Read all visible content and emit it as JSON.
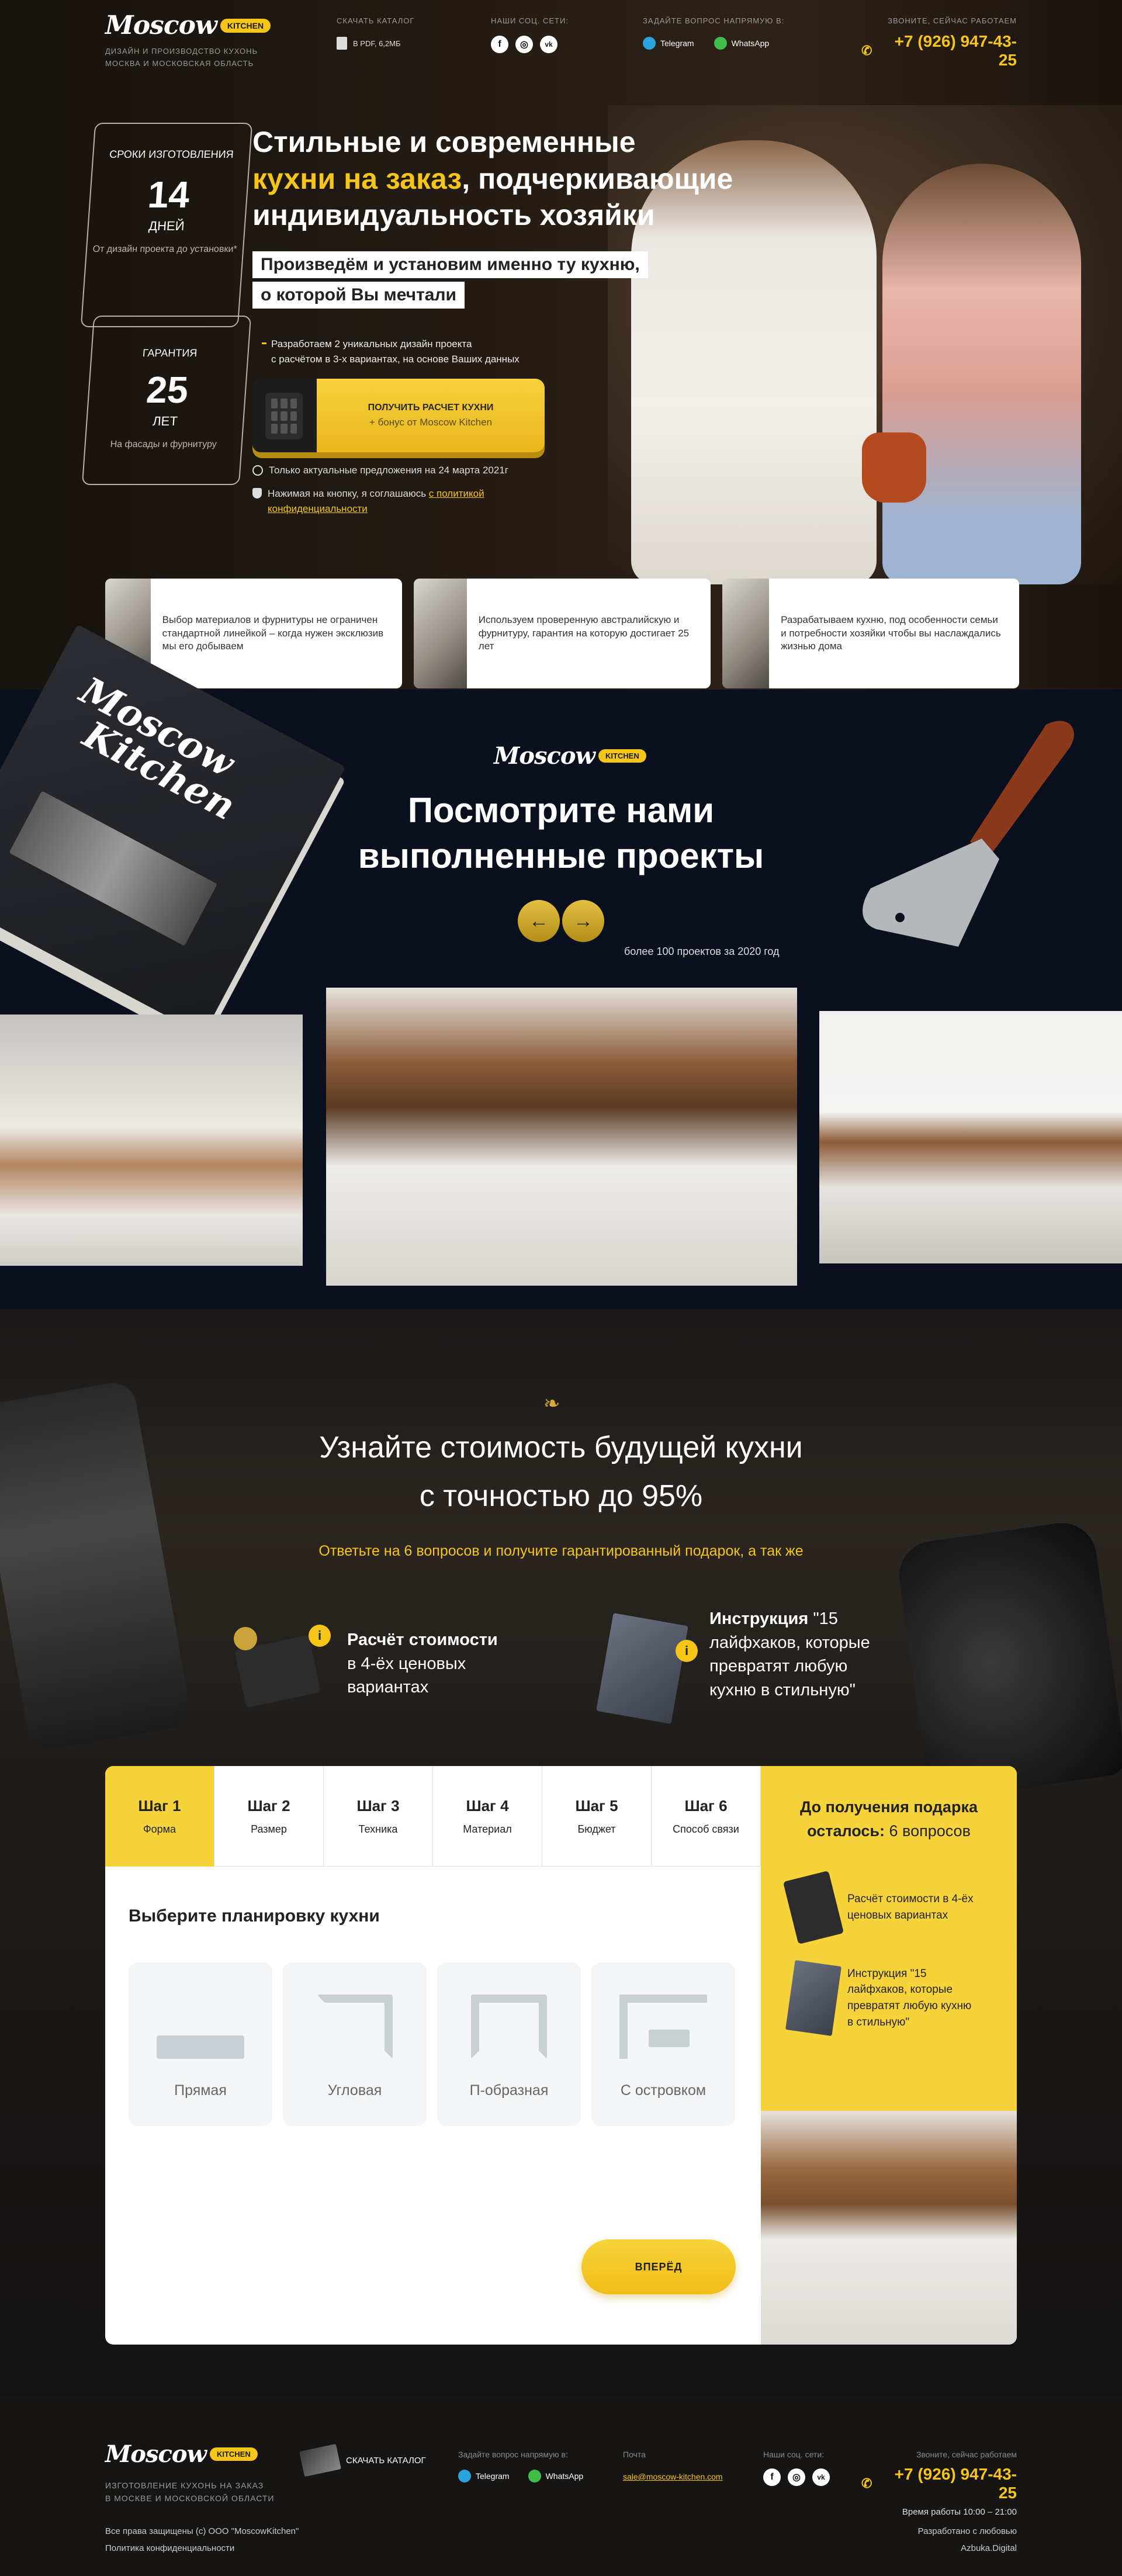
{
  "header": {
    "logo_word": "Moscow",
    "logo_badge": "KITCHEN",
    "tagline_line1": "ДИЗАЙН И ПРОИЗВОДСТВО КУХОНЬ",
    "tagline_line2": "МОСКВА И МОСКОВСКАЯ ОБЛАСТЬ",
    "catalog_label": "СКАЧАТЬ КАТАЛОГ",
    "catalog_file": "В PDF, 6,2МБ",
    "social_label": "НАШИ СОЦ. СЕТИ:",
    "social_icons": [
      "facebook-icon",
      "instagram-icon",
      "vk-icon"
    ],
    "social_glyphs": [
      "f",
      "◎",
      "vk"
    ],
    "ask_label": "ЗАДАЙТЕ ВОПРОС НАПРЯМУЮ В:",
    "telegram": "Telegram",
    "whatsapp": "WhatsApp",
    "call_label": "ЗВОНИТЕ, СЕЙЧАС РАБОТАЕМ",
    "phone": "+7 (926) 947-43-25"
  },
  "hero": {
    "title_line1": "Стильные и современные",
    "title_line2_accent": "кухни на заказ",
    "title_line2_rest": ", подчеркивающие",
    "title_line3": "индивидуальность хозяйки",
    "subtitle_line1": "Произведём и установим именно ту кухню,",
    "subtitle_line2": "о которой Вы мечтали",
    "bullet_line1": "Разработаем 2 уникальных дизайн проекта",
    "bullet_line2": "с расчётом в 3-х вариантах, на основе Ваших данных",
    "cta_title": "ПОЛУЧИТЬ РАСЧЕТ КУХНИ",
    "cta_sub": "+ бонус от Moscow Kitchen",
    "note_offer": "Только актуальные предложения на 24 марта 2021г",
    "note_agree_prefix": "Нажимая на кнопку, я соглашаюсь ",
    "note_agree_link": "с политикой конфиденциальности",
    "card1": {
      "label": "СРОКИ ИЗГОТОВЛЕНИЯ",
      "number": "14",
      "unit": "ДНЕЙ",
      "sub": "От дизайн проекта до установки*"
    },
    "card2": {
      "label": "ГАРАНТИЯ",
      "number": "25",
      "unit": "ЛЕТ",
      "sub": "На фасады и фурнитуру"
    }
  },
  "features": [
    {
      "text": "Выбор материалов и фурнитуры не ограничен стандартной линейкой – когда нужен эксклюзив мы его добываем"
    },
    {
      "text": "Используем проверенную австралийскую и фурнитуру, гарантия на которую достигает 25 лет"
    },
    {
      "text": "Разрабатываем кухню, под особенности семьи и потребности хозяйки чтобы вы наслаждались жизнью дома"
    }
  ],
  "projects": {
    "box_word1": "Moscow",
    "box_word2": "Kitchen",
    "title_line1": "Посмотрите нами",
    "title_line2": "выполненные проекты",
    "prev_arrow": "←",
    "next_arrow": "→",
    "count_note": "более 100 проектов за 2020 год"
  },
  "quiz": {
    "ornament": "❧",
    "title_line1": "Узнайте стоимость будущей кухни",
    "title_line2": "с точностью до 95%",
    "subtitle": "Ответьте на 6 вопросов и получите гарантированный подарок, а так же",
    "gift1_strong": "Расчёт стоимости",
    "gift1_rest": "в 4-ёх ценовых вариантах",
    "gift2_strong": "Инструкция",
    "gift2_rest": "\"15 лайфхаков, которые превратят любую кухню в стильную\"",
    "tabs": [
      {
        "step": "Шаг 1",
        "name": "Форма"
      },
      {
        "step": "Шаг 2",
        "name": "Размер"
      },
      {
        "step": "Шаг 3",
        "name": "Техника"
      },
      {
        "step": "Шаг 4",
        "name": "Материал"
      },
      {
        "step": "Шаг 5",
        "name": "Бюджет"
      },
      {
        "step": "Шаг 6",
        "name": "Способ связи"
      }
    ],
    "question": "Выберите планировку кухни",
    "options": [
      "Прямая",
      "Угловая",
      "П-образная",
      "С островком"
    ],
    "next_button": "ВПЕРЁД",
    "side_title_line1": "До получения подарка",
    "side_title_prefix": "осталось:",
    "side_title_value": "6 вопросов",
    "side_gift1": "Расчёт стоимости в 4-ёх ценовых вариантах",
    "side_gift2": "Инструкция \"15 лайфхаков, которые превратят любую кухню в стильную\""
  },
  "footer": {
    "tagline_line1": "ИЗГОТОВЛЕНИЕ КУХОНЬ НА ЗАКАЗ",
    "tagline_line2": "В МОСКВЕ И МОСКОВСКОЙ ОБЛАСТИ",
    "catalog": "СКАЧАТЬ КАТАЛОГ",
    "ask_label": "Задайте вопрос напрямую в:",
    "mail_label": "Почта",
    "email": "sale@moscow-kitchen.com",
    "social_label": "Наши соц. сети:",
    "call_label": "Звоните, сейчас работаем",
    "phone": "+7 (926) 947-43-25",
    "hours": "Время работы 10:00 – 21:00",
    "copyright": "Все права защищены (с) ООО \"MoscowKitchen\"",
    "privacy": "Политика конфиденциальности",
    "made_by": "Разработано с любовью",
    "agency": "Azbuka.Digital"
  },
  "colors": {
    "accent": "#f5c518",
    "dark": "#0b101e"
  }
}
